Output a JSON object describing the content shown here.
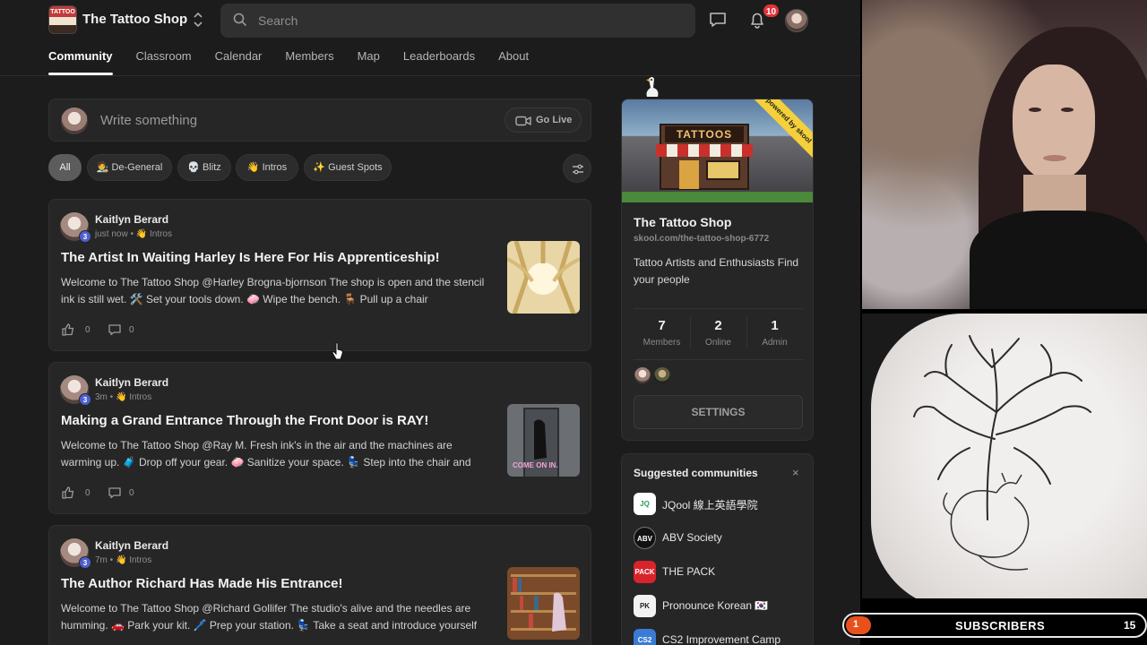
{
  "app": {
    "name": "The Tattoo Shop",
    "logo_text": "TATTOO"
  },
  "search": {
    "placeholder": "Search"
  },
  "notifications": {
    "count": "10"
  },
  "nav": {
    "tabs": [
      {
        "label": "Community",
        "active": true
      },
      {
        "label": "Classroom"
      },
      {
        "label": "Calendar"
      },
      {
        "label": "Members"
      },
      {
        "label": "Map"
      },
      {
        "label": "Leaderboards"
      },
      {
        "label": "About"
      }
    ]
  },
  "composer": {
    "placeholder": "Write something",
    "go_live": "Go Live"
  },
  "filters": [
    {
      "label": "All"
    },
    {
      "label": "🧑‍🎨 De-General"
    },
    {
      "label": "💀 Blitz"
    },
    {
      "label": "👋 Intros"
    },
    {
      "label": "✨ Guest Spots"
    }
  ],
  "posts": [
    {
      "author": "Kaitlyn Berard",
      "level": "3",
      "time": "just now",
      "category": "👋 Intros",
      "title": "The Artist In Waiting Harley Is Here For His Apprenticeship!",
      "body": "Welcome to The Tattoo Shop @Harley Brogna-bjornson The shop is open and the stencil ink is still wet. 🛠️ Set your tools down. 🧼 Wipe the bench. 🪑 Pull up a chair",
      "likes": "0",
      "comments": "0"
    },
    {
      "author": "Kaitlyn Berard",
      "level": "3",
      "time": "3m",
      "category": "👋 Intros",
      "title": "Making a Grand Entrance Through the Front Door is RAY!",
      "body": "Welcome to The Tattoo Shop @Ray M. Fresh ink's in the air and the machines are warming up. 🧳 Drop off your gear. 🧼 Sanitize your space. 💺 Step into the chair and",
      "likes": "0",
      "comments": "0",
      "thumb_caption": "COME ON IN."
    },
    {
      "author": "Kaitlyn Berard",
      "level": "3",
      "time": "7m",
      "category": "👋 Intros",
      "title": "The Author Richard Has Made His Entrance!",
      "body": "Welcome to The Tattoo Shop @Richard Gollifer The studio's alive and the needles are humming. 🚗 Park your kit. 🖊️ Prep your station. 💺 Take a seat and introduce yourself",
      "likes": "0",
      "comments": "0"
    }
  ],
  "about": {
    "banner_sign": "TATTOOS",
    "ribbon": "powered by skool",
    "name": "The Tattoo Shop",
    "url": "skool.com/the-tattoo-shop-6772",
    "description": "Tattoo Artists and Enthusiasts Find your people",
    "stats": [
      {
        "value": "7",
        "label": "Members"
      },
      {
        "value": "2",
        "label": "Online"
      },
      {
        "value": "1",
        "label": "Admin"
      }
    ],
    "settings_label": "SETTINGS"
  },
  "suggested": {
    "title": "Suggested communities",
    "close": "×",
    "items": [
      {
        "name": "JQool 線上英語學院",
        "icon_text": "JQ",
        "color": "#ffffff"
      },
      {
        "name": "ABV Society",
        "icon_text": "ABV",
        "color": "#111111"
      },
      {
        "name": "THE PACK",
        "icon_text": "PACK",
        "color": "#d9232a"
      },
      {
        "name": "Pronounce Korean 🇰🇷",
        "icon_text": "PK",
        "color": "#f2f2f2"
      },
      {
        "name": "CS2 Improvement Camp",
        "icon_text": "CS2",
        "color": "#3a7bd5"
      }
    ]
  },
  "subscribers": {
    "current": "1",
    "label": "SUBSCRIBERS",
    "goal": "15",
    "progress": 0.0667
  },
  "colors": {
    "accent": "#e0333a",
    "level_badge": "#4d5fd1",
    "subs_progress": "#e8511c"
  }
}
